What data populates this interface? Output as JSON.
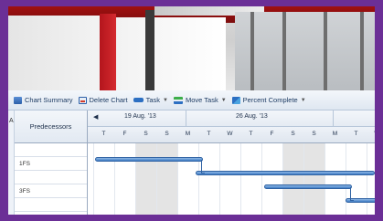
{
  "toolbar": {
    "chart_summary": "Chart Summary",
    "delete_chart": "Delete Chart",
    "task": "Task",
    "move_task": "Move Task",
    "percent_complete": "Percent Complete"
  },
  "grid": {
    "col_a_header": "A",
    "predecessors_header": "Predecessors",
    "rows": [
      "",
      "1FS",
      "",
      "3FS",
      ""
    ]
  },
  "timeline": {
    "weeks": [
      "19 Aug. '13",
      "26 Aug. '13"
    ],
    "days": [
      "T",
      "F",
      "S",
      "S",
      "M",
      "T",
      "W",
      "T",
      "F",
      "S",
      "S",
      "M",
      "T",
      "W"
    ]
  },
  "colors": {
    "frame": "#6b2f96",
    "bar": "#3f7cc4",
    "toolbar_text": "#1d3b63"
  }
}
